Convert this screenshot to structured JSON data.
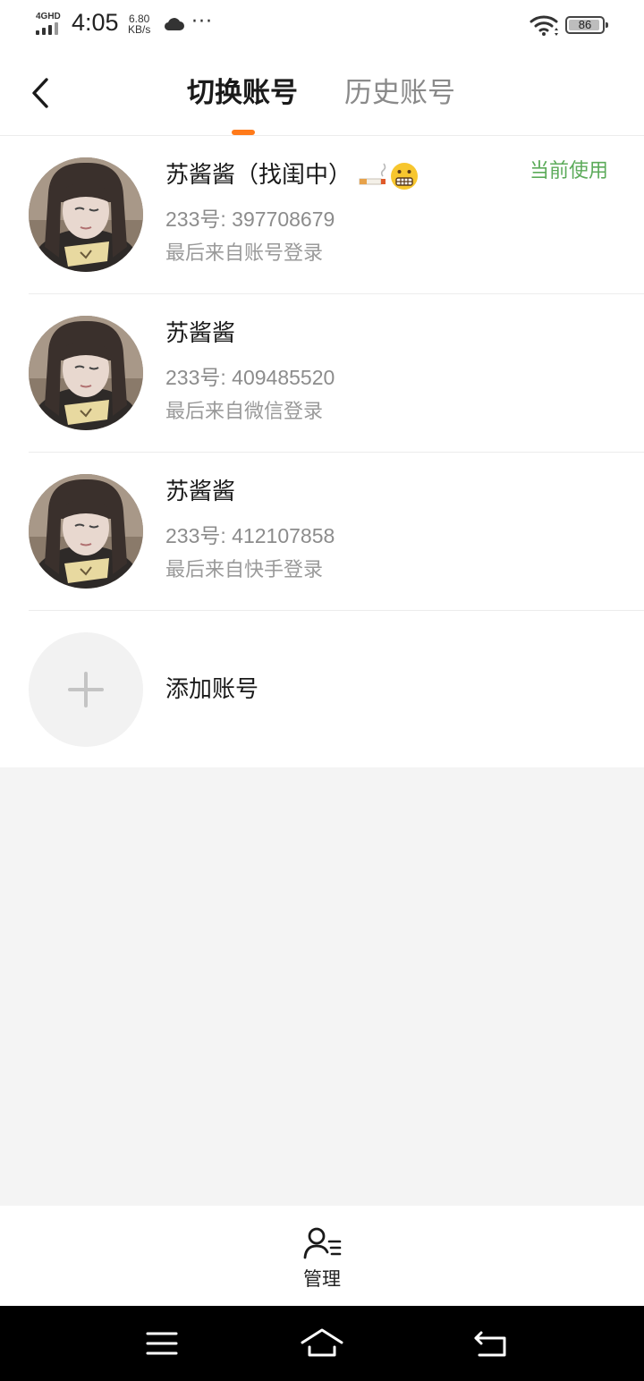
{
  "status_bar": {
    "network": "4GHD",
    "time": "4:05",
    "speed_value": "6.80",
    "speed_unit": "KB/s",
    "more": "···",
    "battery": "86",
    "icons": [
      "signal-icon",
      "cloud-icon",
      "wifi-icon",
      "battery-icon"
    ]
  },
  "header": {
    "tabs": [
      {
        "label": "切换账号",
        "active": true
      },
      {
        "label": "历史账号",
        "active": false
      }
    ],
    "accent_color": "#ff7a1a"
  },
  "accounts": [
    {
      "name": "苏酱酱（找闺中）",
      "name_emojis": [
        "cigarette-emoji",
        "grimacing-face-emoji"
      ],
      "id": "233号: 397708679",
      "source": "最后来自账号登录",
      "badge": "当前使用"
    },
    {
      "name": "苏酱酱",
      "id": "233号: 409485520",
      "source": "最后来自微信登录"
    },
    {
      "name": "苏酱酱",
      "id": "233号: 412107858",
      "source": "最后来自快手登录"
    }
  ],
  "add_account": {
    "label": "添加账号"
  },
  "manage": {
    "label": "管理"
  },
  "colors": {
    "current_badge": "#5cab5a",
    "secondary_text": "#8c8c8c",
    "page_background": "#f4f4f4"
  }
}
